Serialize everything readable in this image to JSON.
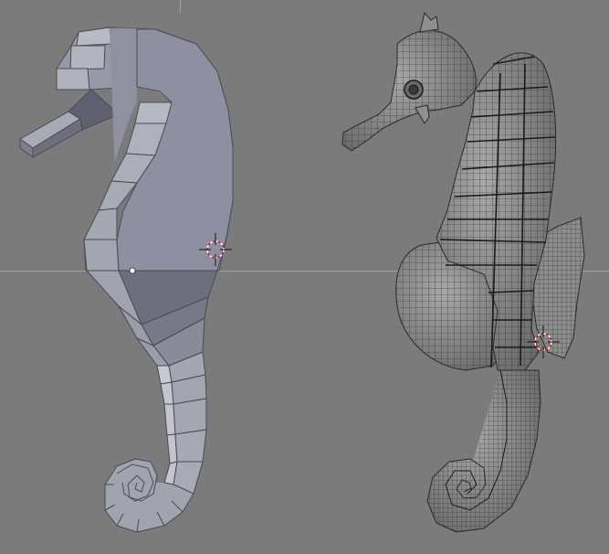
{
  "viewport": {
    "background_color": "#7b7b7b",
    "grid_axis_color": "#a0a0a0",
    "cursor_color": "#e03030"
  },
  "objects": [
    {
      "name": "seahorse-low-poly",
      "shading": "solid-flat",
      "base_color": "#8e8f9e"
    },
    {
      "name": "seahorse-subdivided",
      "shading": "wireframe-smooth",
      "base_color": "#8a8a8a"
    }
  ]
}
